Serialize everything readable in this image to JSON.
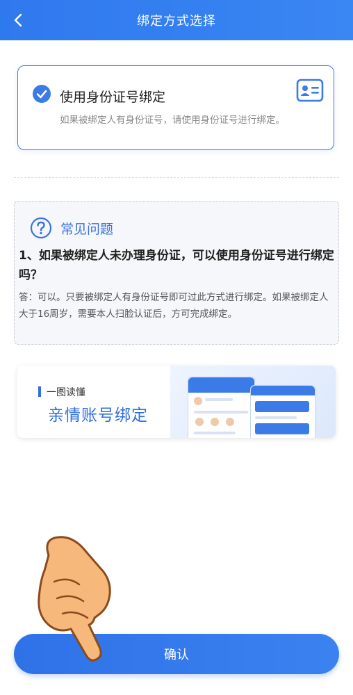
{
  "header": {
    "title": "绑定方式选择",
    "back_icon": "chevron-left-icon"
  },
  "option": {
    "title": "使用身份证号绑定",
    "description": "如果被绑定人有身份证号，请使用身份证号进行绑定。",
    "selected": true,
    "check_icon": "check-circle-icon",
    "card_icon": "id-card-icon"
  },
  "faq": {
    "icon": "question-circle-icon",
    "title": "常见问题",
    "question": "1、如果被绑定人未办理身份证，可以使用身份证号进行绑定吗？",
    "answer": "答：可以。只要被绑定人有身份证号即可过此方式进行绑定。如果被绑定人大于16周岁，需要本人扫脸认证后，方可完成绑定。"
  },
  "banner": {
    "label": "一图读懂",
    "title": "亲情账号绑定"
  },
  "confirm": {
    "label": "确认"
  },
  "colors": {
    "primary": "#3a7be8",
    "header": "#2f79ee",
    "faq_title": "#3a73e0",
    "faq_bg": "#f5f7fa"
  }
}
